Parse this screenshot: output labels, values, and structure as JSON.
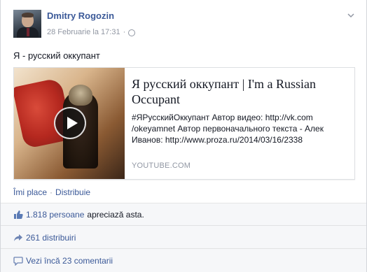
{
  "post": {
    "author": "Dmitry Rogozin",
    "timestamp": "28 Februarie la 17:31",
    "separator": "·",
    "text": "Я - русский оккупант"
  },
  "share": {
    "title": "Я русский оккупант | I'm a Russian Occupant",
    "description": "#ЯРусскийОккупант Автор видео: http://vk.com /okeyamnet Автор первоначального текста - Алек Иванов: http://www.proza.ru/2014/03/16/2338",
    "source": "YOUTUBE.COM"
  },
  "actions": {
    "like": "Îmi place",
    "dot": "·",
    "share": "Distribuie"
  },
  "ufi": {
    "likes_count": "1.818 persoane",
    "likes_rest": "apreciază asta.",
    "shares": "261 distribuiri",
    "comments": "Vezi încă 23 comentarii"
  },
  "icons": {
    "options": "chevron-down-icon",
    "privacy": "globe-icon",
    "play": "play-icon",
    "like": "thumbs-up-icon",
    "share": "share-arrow-icon",
    "comment": "comment-icon"
  },
  "colors": {
    "link": "#3b5998",
    "muted": "#9197a3",
    "ufi_background": "#f6f7f9"
  }
}
